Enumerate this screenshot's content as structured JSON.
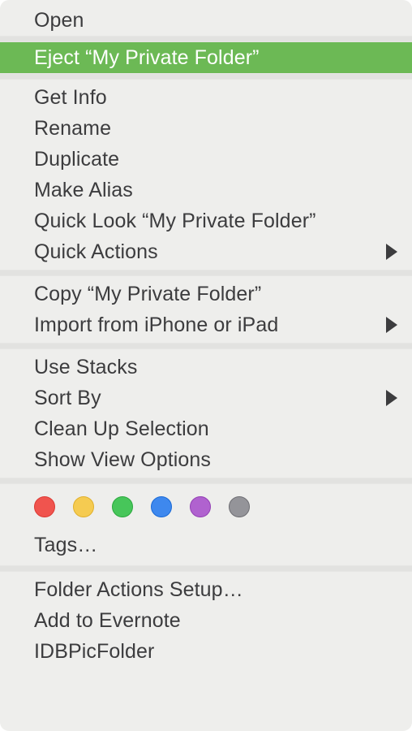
{
  "menu": {
    "background_color": "#eeeeec",
    "text_color": "#3c3c3e",
    "highlight_color": "#6cb955",
    "highlight_text_color": "#ffffff",
    "separator_color": "#e2e2e0",
    "sections": [
      {
        "name": "open-section",
        "items": [
          {
            "label": "Open",
            "has_submenu": false,
            "highlighted": false
          }
        ]
      },
      {
        "name": "eject-section",
        "items": [
          {
            "label": "Eject “My Private Folder”",
            "has_submenu": false,
            "highlighted": true
          }
        ]
      },
      {
        "name": "file-actions-section",
        "items": [
          {
            "label": "Get Info",
            "has_submenu": false,
            "highlighted": false
          },
          {
            "label": "Rename",
            "has_submenu": false,
            "highlighted": false
          },
          {
            "label": "Duplicate",
            "has_submenu": false,
            "highlighted": false
          },
          {
            "label": "Make Alias",
            "has_submenu": false,
            "highlighted": false
          },
          {
            "label": "Quick Look “My Private Folder”",
            "has_submenu": false,
            "highlighted": false
          },
          {
            "label": "Quick Actions",
            "has_submenu": true,
            "highlighted": false
          }
        ]
      },
      {
        "name": "clipboard-section",
        "items": [
          {
            "label": "Copy “My Private Folder”",
            "has_submenu": false,
            "highlighted": false
          },
          {
            "label": "Import from iPhone or iPad",
            "has_submenu": true,
            "highlighted": false
          }
        ]
      },
      {
        "name": "view-section",
        "items": [
          {
            "label": "Use Stacks",
            "has_submenu": false,
            "highlighted": false
          },
          {
            "label": "Sort By",
            "has_submenu": true,
            "highlighted": false
          },
          {
            "label": "Clean Up Selection",
            "has_submenu": false,
            "highlighted": false
          },
          {
            "label": "Show View Options",
            "has_submenu": false,
            "highlighted": false
          }
        ]
      },
      {
        "name": "services-section",
        "items": [
          {
            "label": "Folder Actions Setup…",
            "has_submenu": false,
            "highlighted": false
          },
          {
            "label": "Add to Evernote",
            "has_submenu": false,
            "highlighted": false
          },
          {
            "label": "IDBPicFolder",
            "has_submenu": false,
            "highlighted": false
          }
        ]
      }
    ],
    "tags": {
      "label": "Tags…",
      "dots": [
        {
          "name": "red",
          "fill": "#f0544e",
          "border": "#dc3a34"
        },
        {
          "name": "yellow",
          "fill": "#f5cb51",
          "border": "#e0b02c"
        },
        {
          "name": "green",
          "fill": "#47c65a",
          "border": "#2ba83e"
        },
        {
          "name": "blue",
          "fill": "#3e88ee",
          "border": "#1a6ad6"
        },
        {
          "name": "purple",
          "fill": "#b062cf",
          "border": "#9440b5"
        },
        {
          "name": "gray",
          "fill": "#949499",
          "border": "#6e6e73"
        }
      ]
    }
  }
}
